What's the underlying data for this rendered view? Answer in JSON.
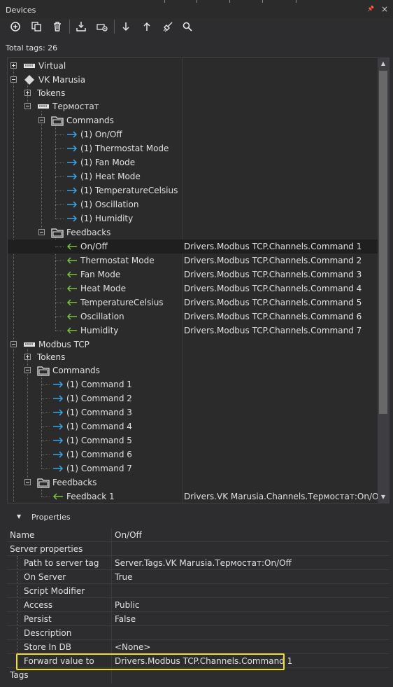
{
  "window": {
    "title": "Devices",
    "pin_glyph": "📌",
    "close_glyph": "×"
  },
  "toolbar": {
    "buttons": [
      {
        "name": "add-icon"
      },
      {
        "name": "copy-icon"
      },
      {
        "name": "delete-icon"
      },
      {
        "name": "import-icon"
      },
      {
        "name": "device-settings-icon"
      },
      {
        "name": "move-down-icon"
      },
      {
        "name": "move-up-icon"
      },
      {
        "name": "clear-icon"
      },
      {
        "name": "search-icon"
      }
    ]
  },
  "total_tags": "Total tags: 26",
  "tree": {
    "rows": [
      {
        "label": "Virtual",
        "value": ""
      },
      {
        "label": "VK Marusia",
        "value": ""
      },
      {
        "label": "Tokens",
        "value": ""
      },
      {
        "label": "Термостат",
        "value": ""
      },
      {
        "label": "Commands",
        "value": ""
      },
      {
        "label": "(1) On/Off",
        "value": ""
      },
      {
        "label": "(1) Thermostat Mode",
        "value": ""
      },
      {
        "label": "(1) Fan Mode",
        "value": ""
      },
      {
        "label": "(1) Heat Mode",
        "value": ""
      },
      {
        "label": "(1) TemperatureCelsius",
        "value": ""
      },
      {
        "label": "(1) Oscillation",
        "value": ""
      },
      {
        "label": "(1) Humidity",
        "value": ""
      },
      {
        "label": "Feedbacks",
        "value": ""
      },
      {
        "label": "On/Off",
        "value": "Drivers.Modbus TCP.Channels.Command 1"
      },
      {
        "label": "Thermostat Mode",
        "value": "Drivers.Modbus TCP.Channels.Command 2"
      },
      {
        "label": "Fan Mode",
        "value": "Drivers.Modbus TCP.Channels.Command 3"
      },
      {
        "label": "Heat Mode",
        "value": "Drivers.Modbus TCP.Channels.Command 4"
      },
      {
        "label": "TemperatureCelsius",
        "value": "Drivers.Modbus TCP.Channels.Command 5"
      },
      {
        "label": "Oscillation",
        "value": "Drivers.Modbus TCP.Channels.Command 6"
      },
      {
        "label": "Humidity",
        "value": "Drivers.Modbus TCP.Channels.Command 7"
      },
      {
        "label": "Modbus TCP",
        "value": ""
      },
      {
        "label": "Tokens",
        "value": ""
      },
      {
        "label": "Commands",
        "value": ""
      },
      {
        "label": "(1) Command 1",
        "value": ""
      },
      {
        "label": "(1) Command 2",
        "value": ""
      },
      {
        "label": "(1) Command 3",
        "value": ""
      },
      {
        "label": "(1) Command 4",
        "value": ""
      },
      {
        "label": "(1) Command 5",
        "value": ""
      },
      {
        "label": "(1) Command 6",
        "value": ""
      },
      {
        "label": "(1) Command 7",
        "value": ""
      },
      {
        "label": "Feedbacks",
        "value": ""
      },
      {
        "label": "Feedback 1",
        "value": "Drivers.VK Marusia.Channels.Термостат:On/Off"
      }
    ]
  },
  "properties": {
    "header": "Properties",
    "rows": [
      {
        "name": "Name",
        "value": "On/Off"
      },
      {
        "name": "Server properties",
        "value": ""
      },
      {
        "name": "Path to server tag",
        "value": "Server.Tags.VK Marusia.Термостат:On/Off"
      },
      {
        "name": "On Server",
        "value": "True"
      },
      {
        "name": "Script Modifier",
        "value": ""
      },
      {
        "name": "Access",
        "value": "Public"
      },
      {
        "name": "Persist",
        "value": "False"
      },
      {
        "name": "Description",
        "value": ""
      },
      {
        "name": "Store In DB",
        "value": "<None>"
      },
      {
        "name": "Forward value to",
        "value": "Drivers.Modbus TCP.Channels.Command 1"
      },
      {
        "name": "Tags",
        "value": ""
      }
    ]
  },
  "colors": {
    "background": "#2d2d30",
    "command_arrow": "#3aa6e8",
    "feedback_arrow": "#7dc242",
    "highlight": "#f0e020"
  }
}
